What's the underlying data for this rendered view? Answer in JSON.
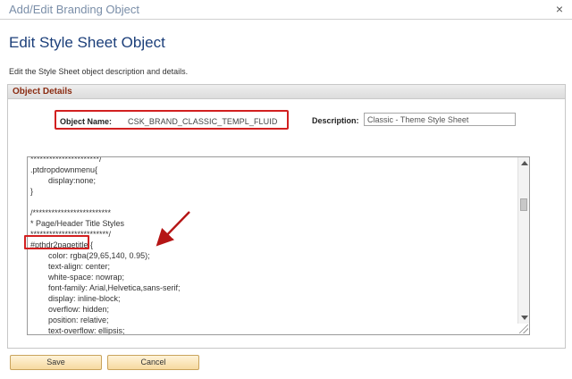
{
  "window": {
    "title": "Add/Edit Branding Object",
    "close_glyph": "×"
  },
  "page": {
    "title": "Edit Style Sheet Object",
    "instructions": "Edit the Style Sheet object description and details."
  },
  "group": {
    "header": "Object Details"
  },
  "fields": {
    "object_name_label": "Object Name:",
    "object_name_value": "CSK_BRAND_CLASSIC_TEMPL_FLUID",
    "description_label": "Description:",
    "description_value": "Classic - Theme Style Sheet"
  },
  "editor": {
    "lines": [
      "**********************/",
      ".ptdropdownmenu{",
      "        display:none;",
      "}",
      "",
      "/*************************",
      "* Page/Header Title Styles",
      "*************************/",
      "#pthdr2pagetitle {",
      "        color: rgba(29,65,140, 0.95);",
      "        text-align: center;",
      "        white-space: nowrap;",
      "        font-family: Arial,Helvetica,sans-serif;",
      "        display: inline-block;",
      "        overflow: hidden;",
      "        position: relative;",
      "        text-overflow: ellipsis;"
    ]
  },
  "buttons": {
    "save": "Save",
    "cancel": "Cancel"
  },
  "colors": {
    "highlight": "#d22020",
    "title": "#1c3f7a",
    "group_header_text": "#8b2c12"
  }
}
